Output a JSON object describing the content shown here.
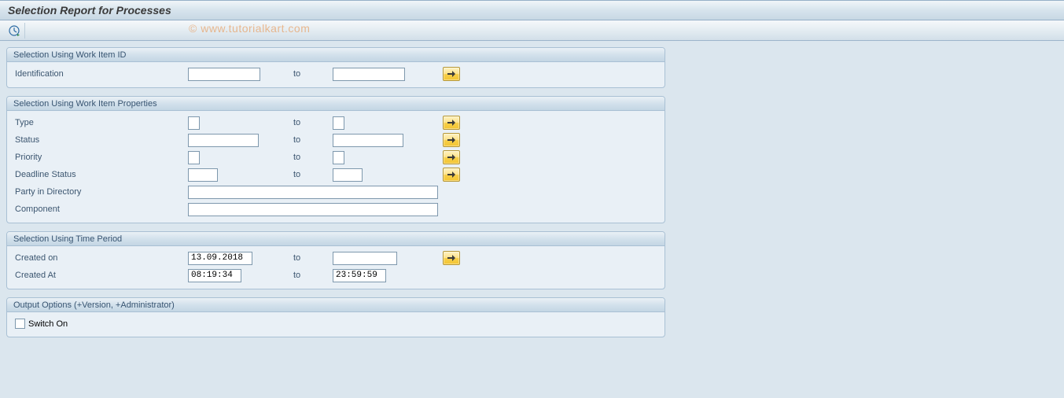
{
  "title": "Selection Report for Processes",
  "watermark": "© www.tutorialkart.com",
  "to_label": "to",
  "groups": {
    "work_item_id": {
      "title": "Selection Using Work Item ID",
      "identification": {
        "label": "Identification",
        "from": "",
        "to": ""
      }
    },
    "work_item_props": {
      "title": "Selection Using Work Item Properties",
      "type": {
        "label": "Type",
        "from": "",
        "to": ""
      },
      "status": {
        "label": "Status",
        "from": "",
        "to": ""
      },
      "priority": {
        "label": "Priority",
        "from": "",
        "to": ""
      },
      "deadline_status": {
        "label": "Deadline Status",
        "from": "",
        "to": ""
      },
      "party": {
        "label": "Party in Directory",
        "value": ""
      },
      "component": {
        "label": "Component",
        "value": ""
      }
    },
    "time_period": {
      "title": "Selection Using Time Period",
      "created_on": {
        "label": "Created on",
        "from": "13.09.2018",
        "to": ""
      },
      "created_at": {
        "label": "Created At",
        "from": "08:19:34",
        "to": "23:59:59"
      }
    },
    "output_opts": {
      "title": "Output Options (+Version, +Administrator)",
      "switch_on": {
        "label": "Switch On",
        "checked": false
      }
    }
  }
}
